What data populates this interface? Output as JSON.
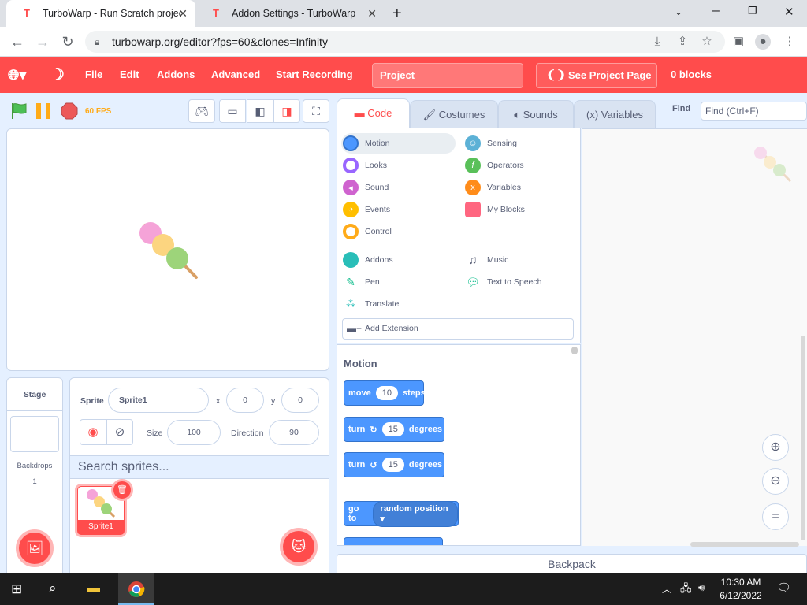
{
  "browser": {
    "tabs": [
      {
        "title": "TurboWarp - Run Scratch project",
        "active": true
      },
      {
        "title": "Addon Settings - TurboWarp",
        "active": false
      }
    ],
    "url": "turbowarp.org/editor?fps=60&clones=Infinity"
  },
  "menubar": {
    "items": [
      "File",
      "Edit",
      "Addons",
      "Advanced",
      "Start Recording"
    ],
    "project_title": "Project",
    "see_project_page": "See Project Page",
    "block_count": "0 blocks"
  },
  "stage_controls": {
    "fps": "60 FPS"
  },
  "editor_tabs": [
    "Code",
    "Costumes",
    "Sounds",
    "Variables"
  ],
  "find": {
    "label": "Find",
    "placeholder": "Find (Ctrl+F)"
  },
  "categories": {
    "left": [
      {
        "label": "Motion",
        "color": "#4c97ff",
        "selected": true
      },
      {
        "label": "Looks",
        "color": "#9966ff"
      },
      {
        "label": "Sound",
        "color": "#cf63cf"
      },
      {
        "label": "Events",
        "color": "#ffbf00"
      },
      {
        "label": "Control",
        "color": "#ffab19"
      },
      {
        "label": "Addons",
        "color": "#29beb8"
      },
      {
        "label": "Pen",
        "color": "#0fbd8c"
      },
      {
        "label": "Translate",
        "color": "#29beb8"
      }
    ],
    "right": [
      {
        "label": "Sensing",
        "color": "#5cb1d6"
      },
      {
        "label": "Operators",
        "color": "#59c059"
      },
      {
        "label": "Variables",
        "color": "#ff8c1a"
      },
      {
        "label": "My Blocks",
        "color": "#ff6680"
      },
      {
        "label": "Music",
        "color": "#0fbd8c"
      },
      {
        "label": "Text to Speech",
        "color": "#0fbd8c"
      }
    ],
    "add_extension": "Add Extension"
  },
  "palette": {
    "title": "Motion",
    "blocks": {
      "move": {
        "label": "move",
        "value": "10",
        "suffix": "steps"
      },
      "turn_right": {
        "label": "turn",
        "value": "15",
        "suffix": "degrees"
      },
      "turn_left": {
        "label": "turn",
        "value": "15",
        "suffix": "degrees"
      },
      "goto": {
        "label": "go to",
        "option": "random position"
      }
    }
  },
  "sprite_info": {
    "sprite_label": "Sprite",
    "sprite_name": "Sprite1",
    "x_label": "x",
    "x": "0",
    "y_label": "y",
    "y": "0",
    "size_label": "Size",
    "size": "100",
    "direction_label": "Direction",
    "direction": "90",
    "search_placeholder": "Search sprites..."
  },
  "sprite_list": [
    {
      "name": "Sprite1",
      "selected": true
    }
  ],
  "stage_pane": {
    "title": "Stage",
    "backdrops_label": "Backdrops",
    "backdrops_count": "1"
  },
  "backpack": "Backpack",
  "taskbar": {
    "time": "10:30 AM",
    "date": "6/12/2022"
  },
  "colors": {
    "accent": "#ff4c4c",
    "motion": "#4c97ff",
    "background": "#e5f0ff"
  }
}
